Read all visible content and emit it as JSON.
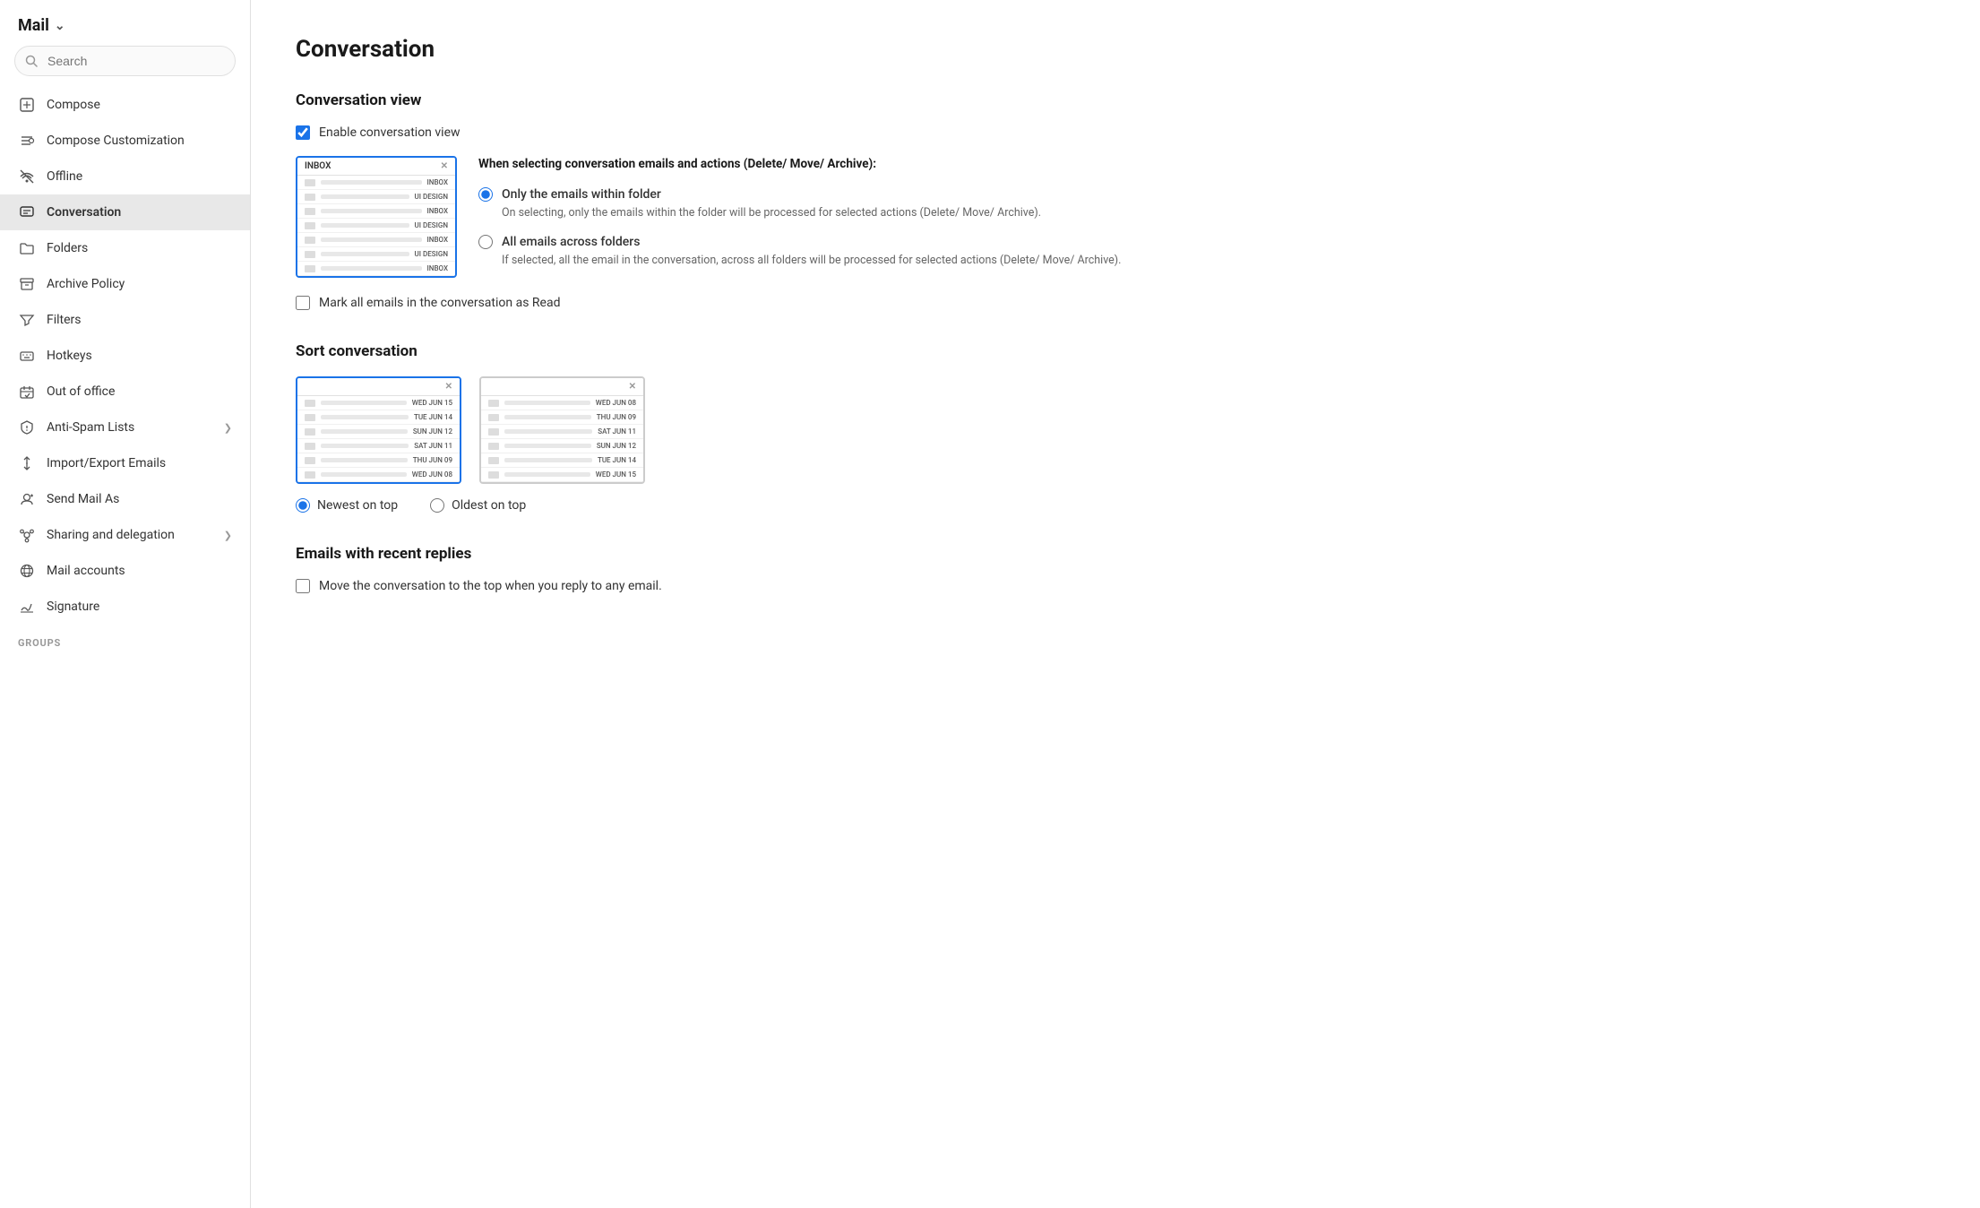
{
  "sidebar": {
    "app_title": "Mail",
    "search_placeholder": "Search",
    "nav_items": [
      {
        "id": "compose",
        "label": "Compose",
        "icon": "compose"
      },
      {
        "id": "compose-customization",
        "label": "Compose Customization",
        "icon": "compose-custom"
      },
      {
        "id": "offline",
        "label": "Offline",
        "icon": "offline"
      },
      {
        "id": "conversation",
        "label": "Conversation",
        "icon": "conversation",
        "active": true
      },
      {
        "id": "folders",
        "label": "Folders",
        "icon": "folders"
      },
      {
        "id": "archive-policy",
        "label": "Archive Policy",
        "icon": "archive"
      },
      {
        "id": "filters",
        "label": "Filters",
        "icon": "filters"
      },
      {
        "id": "hotkeys",
        "label": "Hotkeys",
        "icon": "hotkeys"
      },
      {
        "id": "out-of-office",
        "label": "Out of office",
        "icon": "out-of-office"
      },
      {
        "id": "anti-spam",
        "label": "Anti-Spam Lists",
        "icon": "anti-spam",
        "has_chevron": true
      },
      {
        "id": "import-export",
        "label": "Import/Export Emails",
        "icon": "import-export"
      },
      {
        "id": "send-mail-as",
        "label": "Send Mail As",
        "icon": "send-mail"
      },
      {
        "id": "sharing",
        "label": "Sharing and delegation",
        "icon": "sharing",
        "has_chevron": true
      },
      {
        "id": "mail-accounts",
        "label": "Mail accounts",
        "icon": "mail-accounts"
      },
      {
        "id": "signature",
        "label": "Signature",
        "icon": "signature"
      }
    ],
    "groups_label": "GROUPS"
  },
  "main": {
    "page_title": "Conversation",
    "conversation_view": {
      "section_title": "Conversation view",
      "enable_label": "Enable conversation view",
      "enable_checked": true,
      "options_desc": "When selecting conversation emails and actions (Delete/ Move/ Archive):",
      "radio_options": [
        {
          "id": "only-folder",
          "label": "Only the emails within folder",
          "desc": "On selecting, only the emails within the folder will be processed for selected actions (Delete/ Move/ Archive).",
          "checked": true
        },
        {
          "id": "all-folders",
          "label": "All emails across folders",
          "desc": "If selected, all the email in the conversation, across all folders will be processed for selected actions (Delete/ Move/ Archive).",
          "checked": false
        }
      ],
      "mark_read_label": "Mark all emails in the conversation as Read",
      "mark_read_checked": false,
      "preview": {
        "header": "INBOX",
        "rows": [
          {
            "date": "INBOX",
            "align": "right"
          },
          {
            "date": "UI DESIGN",
            "align": "right"
          },
          {
            "date": "INBOX",
            "align": "right"
          },
          {
            "date": "UI DESIGN",
            "align": "right"
          },
          {
            "date": "INBOX",
            "align": "right"
          },
          {
            "date": "UI DESIGN",
            "align": "right"
          },
          {
            "date": "INBOX",
            "align": "right"
          }
        ]
      }
    },
    "sort_conversation": {
      "section_title": "Sort conversation",
      "newest_label": "Newest on top",
      "oldest_label": "Oldest on top",
      "newest_checked": true,
      "oldest_checked": false,
      "newest_preview_rows": [
        "WED JUN 15",
        "TUE JUN 14",
        "SUN JUN 12",
        "SAT JUN 11",
        "THU JUN 09",
        "WED JUN 08"
      ],
      "oldest_preview_rows": [
        "WED JUN 08",
        "THU JUN 09",
        "SAT JUN 11",
        "SUN JUN 12",
        "TUE JUN 14",
        "WED JUN 15"
      ]
    },
    "recent_replies": {
      "section_title": "Emails with recent replies",
      "move_label": "Move the conversation to the top when you reply to any email.",
      "move_checked": false
    }
  }
}
